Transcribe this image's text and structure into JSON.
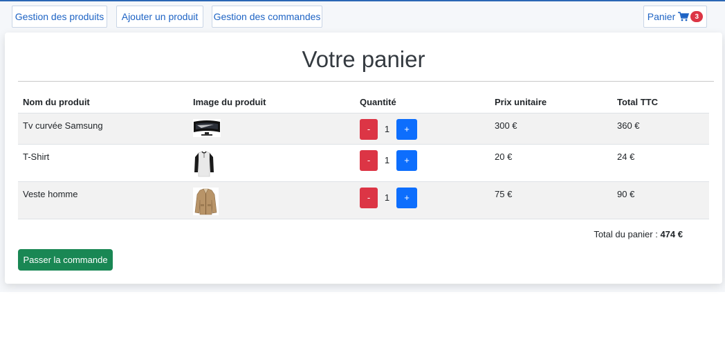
{
  "nav": {
    "products": "Gestion des produits",
    "add": "Ajouter un produit",
    "orders": "Gestion des commandes",
    "cart": "Panier",
    "cart_count": "3"
  },
  "cart": {
    "title": "Votre panier",
    "headers": [
      "Nom du produit",
      "Image du produit",
      "Quantité",
      "Prix unitaire",
      "Total TTC"
    ],
    "items": [
      {
        "name": "Tv curvée Samsung",
        "image": "tv-image",
        "qty": "1",
        "price": "300 €",
        "total": "360 €"
      },
      {
        "name": "T-Shirt",
        "image": "tshirt-image",
        "qty": "1",
        "price": "20 €",
        "total": "24 €"
      },
      {
        "name": "Veste homme",
        "image": "jacket-image",
        "qty": "1",
        "price": "75 €",
        "total": "90 €"
      }
    ],
    "minus": "-",
    "plus": "+",
    "total_label": "Total du panier : ",
    "total_value": "474 €",
    "checkout": "Passer la commande"
  },
  "colors": {
    "primary": "#0d6efd",
    "danger": "#dc3545",
    "success": "#198754",
    "nav_text": "#1d63c4"
  }
}
